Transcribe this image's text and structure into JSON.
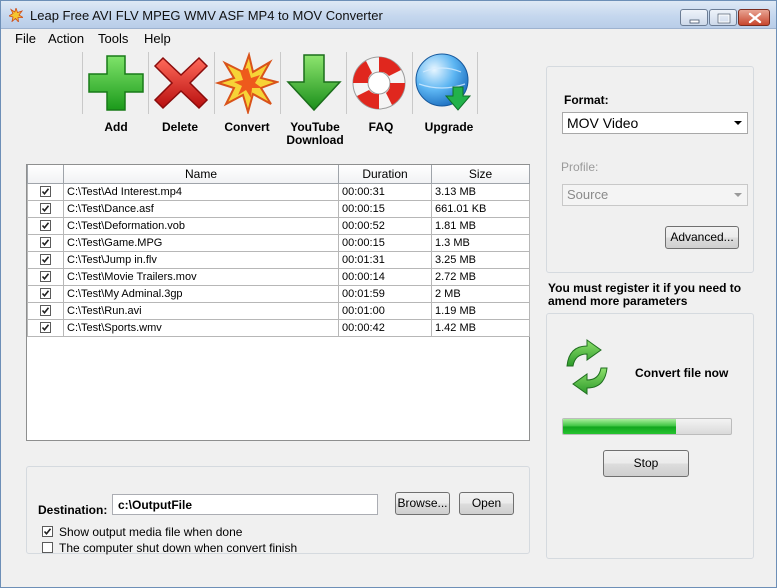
{
  "window": {
    "title": "Leap Free AVI FLV MPEG WMV ASF MP4 to MOV Converter"
  },
  "menu": [
    "File",
    "Action",
    "Tools",
    "Help"
  ],
  "toolbar": {
    "add": "Add",
    "delete": "Delete",
    "convert": "Convert",
    "youtube_line1": "YouTube",
    "youtube_line2": "Download",
    "faq": "FAQ",
    "upgrade": "Upgrade"
  },
  "filelist": {
    "columns": [
      "",
      "Name",
      "Duration",
      "Size"
    ],
    "rows": [
      {
        "checked": true,
        "name": "C:\\Test\\Ad Interest.mp4",
        "duration": "00:00:31",
        "size": "3.13 MB"
      },
      {
        "checked": true,
        "name": "C:\\Test\\Dance.asf",
        "duration": "00:00:15",
        "size": "661.01 KB"
      },
      {
        "checked": true,
        "name": "C:\\Test\\Deformation.vob",
        "duration": "00:00:52",
        "size": "1.81 MB"
      },
      {
        "checked": true,
        "name": "C:\\Test\\Game.MPG",
        "duration": "00:00:15",
        "size": "1.3 MB"
      },
      {
        "checked": true,
        "name": "C:\\Test\\Jump in.flv",
        "duration": "00:01:31",
        "size": "3.25 MB"
      },
      {
        "checked": true,
        "name": "C:\\Test\\Movie Trailers.mov",
        "duration": "00:00:14",
        "size": "2.72 MB"
      },
      {
        "checked": true,
        "name": "C:\\Test\\My Adminal.3gp",
        "duration": "00:01:59",
        "size": "2 MB"
      },
      {
        "checked": true,
        "name": "C:\\Test\\Run.avi",
        "duration": "00:01:00",
        "size": "1.19 MB"
      },
      {
        "checked": true,
        "name": "C:\\Test\\Sports.wmv",
        "duration": "00:00:42",
        "size": "1.42 MB"
      }
    ]
  },
  "destination": {
    "label": "Destination:",
    "value": "c:\\OutputFile",
    "browse": "Browse...",
    "open": "Open",
    "show_output": {
      "label": "Show output media file when done",
      "checked": true
    },
    "shutdown": {
      "label": "The computer shut down when convert finish",
      "checked": false
    }
  },
  "settings": {
    "format_label": "Format:",
    "format_value": "MOV Video",
    "profile_label": "Profile:",
    "profile_value": "Source",
    "advanced": "Advanced..."
  },
  "register_text": "You must register it if you need to amend more parameters",
  "convert": {
    "label": "Convert file now",
    "progress": 0.67,
    "stop": "Stop"
  }
}
